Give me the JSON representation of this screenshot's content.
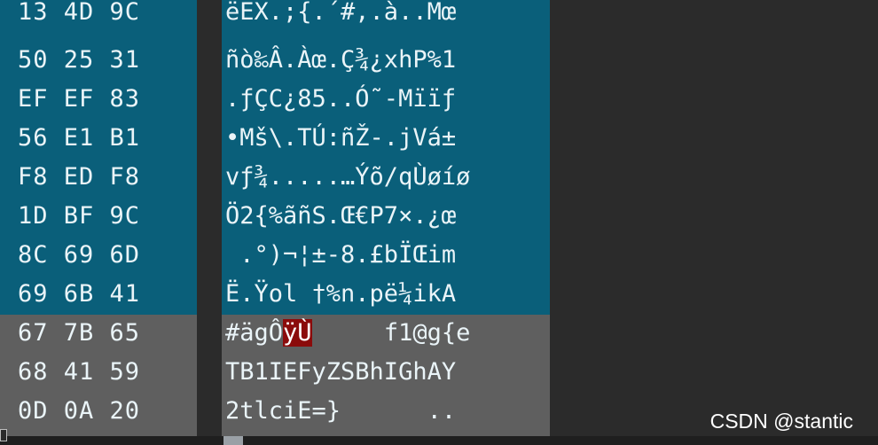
{
  "hex_rows": [
    "13 4D 9C",
    "50 25 31",
    "EF EF 83",
    "56 E1 B1",
    "F8 ED F8",
    "1D BF 9C",
    "8C 69 6D",
    "69 6B 41",
    "67 7B 65",
    "68 41 59",
    "0D 0A 20"
  ],
  "ascii_rows": [
    "ëEX.;{.´#,.à..Mœ",
    "ñò‰Â.Àœ.Ç¾¿xhP%1",
    ".ƒÇC¿85..Ó˜-Mïïƒ",
    "•Mš\\.TÚ:ñŽ-.jVá±",
    "vƒ¾.....…Ýõ/qÙøíø",
    "Ö2{%ãñS.Œ€P7×.¿œ",
    " .°)¬¦±-8.£bÏŒim",
    "Ë.Ÿol †%n.pë¼ikA",
    "",
    "TB1IEFyZSBhIGhAY",
    "2tlciE=}      .."
  ],
  "cursor_row": {
    "before": "#ägÔ",
    "highlight": "ÿÙ",
    "after": "     f1@g{e"
  },
  "watermark": "CSDN @stantic"
}
